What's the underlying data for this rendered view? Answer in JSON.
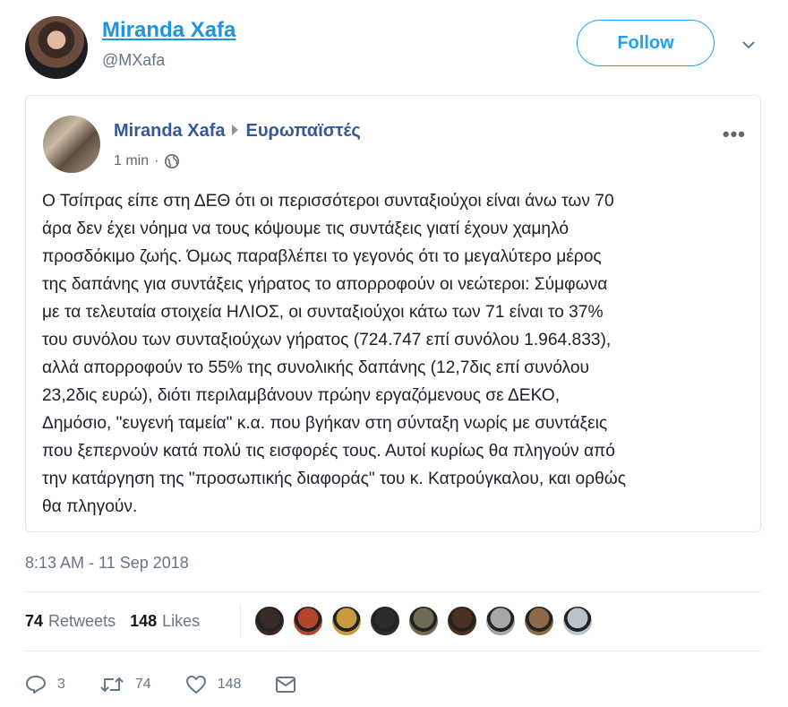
{
  "tweet": {
    "author_name": "Miranda Xafa",
    "author_handle": "@MXafa",
    "follow_label": "Follow",
    "timestamp": "8:13 AM - 11 Sep 2018"
  },
  "embedded_post": {
    "author": "Miranda Xafa",
    "group": "Ευρωπαϊστές",
    "time": "1 min",
    "more_label": "•••",
    "body": "Ο Τσίπρας είπε στη ΔΕΘ ότι οι περισσότεροι συνταξιούχοι είναι άνω των 70\nάρα δεν έχει νόημα να τους κόψουμε τις συντάξεις γιατί έχουν χαμηλό\nπροσδόκιμο ζωής. Όμως παραβλέπει το γεγονός ότι το μεγαλύτερο μέρος\nτης δαπάνης για συντάξεις γήρατος το απορροφούν οι νεώτεροι: Σύμφωνα\nμε τα τελευταία στοιχεία ΗΛΙΟΣ, οι συνταξιούχοι κάτω των 71 είναι το 37%\nτου συνόλου των συνταξιούχων γήρατος (724.747 επί συνόλου 1.964.833),\nαλλά απορροφούν το 55% της συνολικής δαπάνης (12,7δις επί συνόλου\n23,2δις ευρώ), διότι περιλαμβάνουν πρώην εργαζόμενους σε ΔΕΚΟ,\nΔημόσιο, \"ευγενή ταμεία\" κ.α. που βγήκαν στη σύνταξη νωρίς με συντάξεις\nπου ξεπερνούν κατά πολύ τις εισφορές τους. Αυτοί κυρίως θα πληγούν από\nτην κατάργηση της \"προσωπικής διαφοράς\" του κ. Κατρούγκαλου, και ορθώς\nθα πληγούν."
  },
  "stats": {
    "retweets_count": "74",
    "retweets_label": "Retweets",
    "likes_count": "148",
    "likes_label": "Likes"
  },
  "liker_avatar_colors": [
    "#3a2a26",
    "#b5452a",
    "#c79a3f",
    "#2b2b2b",
    "#6f6a55",
    "#4a3122",
    "#a7a7a7",
    "#8c6a4a",
    "#b8c4cc"
  ],
  "actions": {
    "reply_count": "3",
    "retweet_count": "74",
    "like_count": "148"
  },
  "colors": {
    "twitter_blue": "#1da1f2",
    "link_blue": "#1b95e0",
    "facebook_blue": "#365899",
    "muted": "#657786"
  }
}
